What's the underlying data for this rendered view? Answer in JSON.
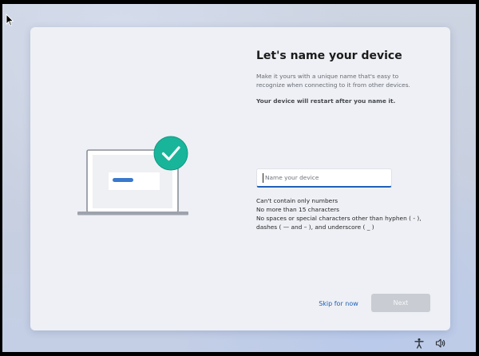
{
  "oobe": {
    "title": "Let's name your device",
    "description": "Make it yours with a unique name that's easy to recognize when connecting to it from other devices.",
    "restart_note": "Your device will restart after you name it.",
    "name_input": {
      "value": "",
      "placeholder": "Name your device"
    },
    "rules": [
      "Can't contain only numbers",
      "No more than 15 characters",
      "No spaces or special characters other than hyphen ( - ), dashes ( — and – ), and underscore ( _ )"
    ],
    "skip_label": "Skip for now",
    "next_label": "Next",
    "next_enabled": false
  },
  "tray": {
    "icons": [
      "accessibility-icon",
      "volume-icon"
    ]
  },
  "colors": {
    "accent": "#1f5fb9",
    "check_badge": "#19b59b",
    "card": "#eef0f5"
  }
}
